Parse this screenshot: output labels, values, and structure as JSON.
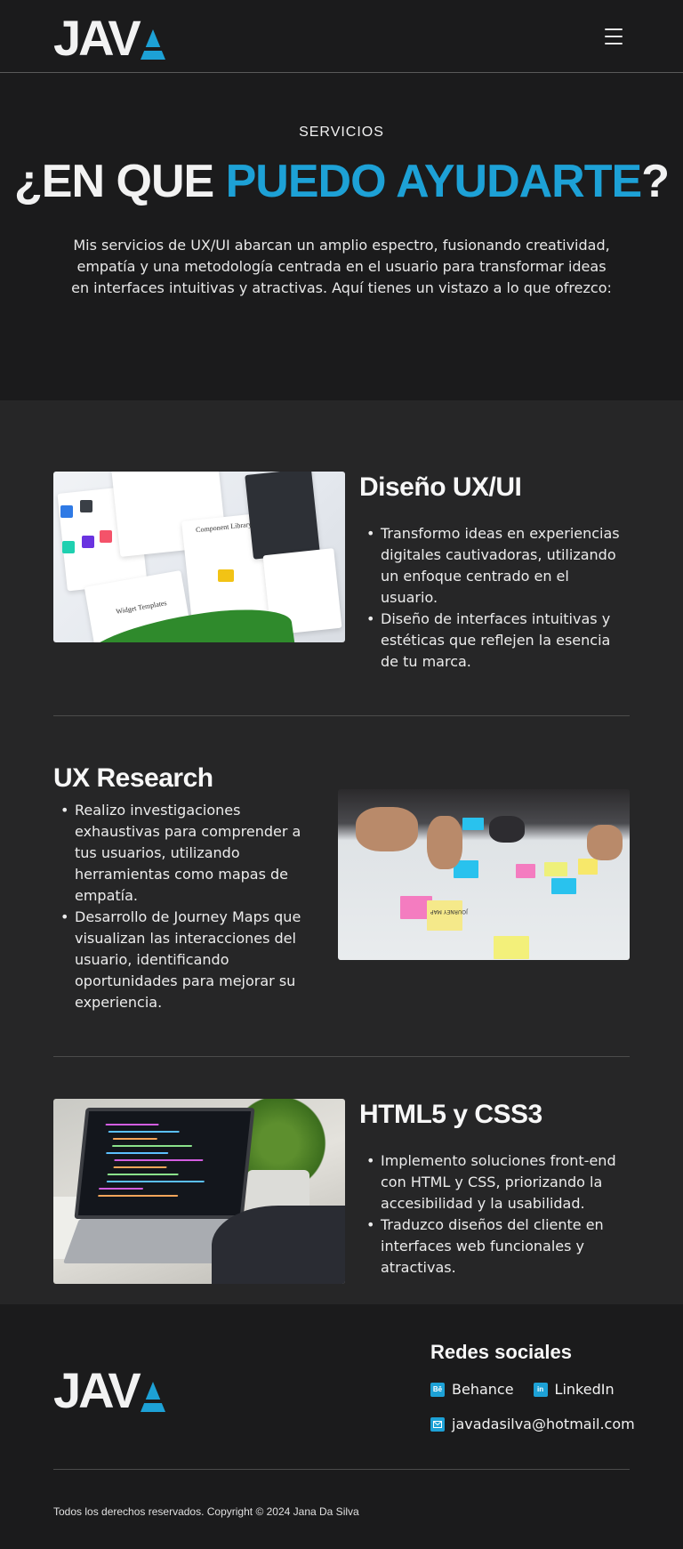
{
  "brand": {
    "logo_text": "JAV",
    "accent_color": "#1da1d6"
  },
  "header": {
    "menu_icon": "hamburger-menu-icon"
  },
  "hero": {
    "eyebrow": "SERVICIOS",
    "title_part1": "¿EN QUE ",
    "title_accent": "PUEDO AYUDARTE",
    "title_part2": "?",
    "description": "Mis servicios de UX/UI abarcan un amplio espectro, fusionando creatividad, empatía y una metodología centrada en el usuario para transformar ideas en interfaces intuitivas y atractivas. Aquí tienes un vistazo a lo que ofrezco:"
  },
  "services": [
    {
      "title": "Diseño UX/UI",
      "bullets": [
        "Transformo ideas en experiencias digitales cautivadoras, utilizando un enfoque centrado en el usuario.",
        "Diseño de interfaces intuitivas y estéticas que reflejen la esencia de tu marca."
      ],
      "image_labels": [
        "Widget Templates",
        "Component Library"
      ]
    },
    {
      "title": "UX Research",
      "bullets": [
        "Realizo investigaciones exhaustivas para comprender a tus usuarios, utilizando herramientas como mapas de empatía.",
        "Desarrollo de Journey Maps que visualizan las interacciones del usuario, identificando oportunidades para mejorar su experiencia."
      ],
      "image_labels": [
        "JOURNEY MAP"
      ]
    },
    {
      "title": "HTML5 y CSS3",
      "bullets": [
        "Implemento soluciones front-end con HTML y CSS, priorizando la accesibilidad y la usabilidad.",
        "Traduzco diseños del cliente en interfaces web funcionales y atractivas."
      ]
    }
  ],
  "footer": {
    "social_title": "Redes sociales",
    "behance_label": "Behance",
    "behance_icon_text": "Bē",
    "linkedin_label": "LinkedIn",
    "linkedin_icon_text": "in",
    "email": "javadasilva@hotmail.com",
    "copyright": "Todos los derechos reservados. Copyright © 2024 Jana Da Silva"
  }
}
